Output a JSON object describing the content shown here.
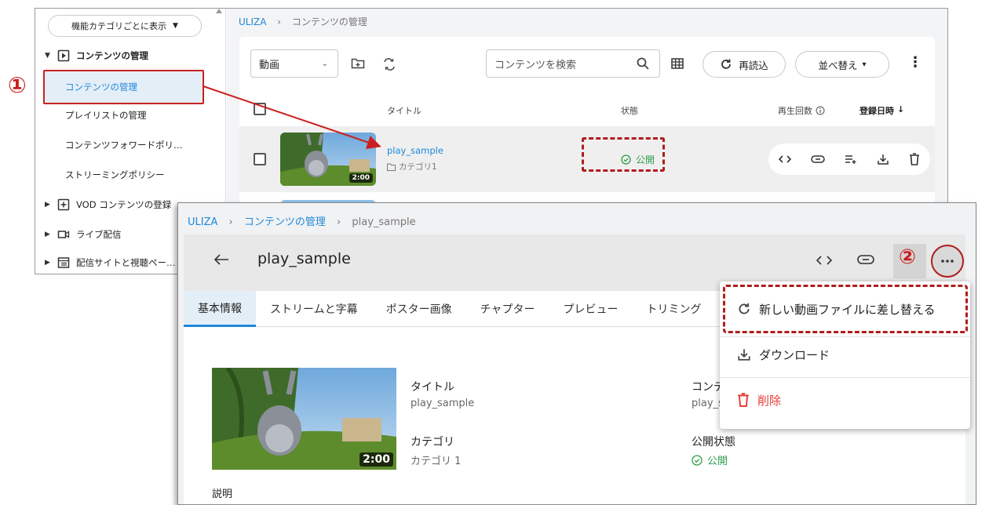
{
  "annotations": {
    "step1": "①",
    "step2": "②"
  },
  "sidebar": {
    "category_chip": "機能カテゴリごとに表示",
    "group_contents": "コンテンツの管理",
    "items": [
      "コンテンツの管理",
      "プレイリストの管理",
      "コンテンツフォワードポリ…",
      "ストリーミングポリシー"
    ],
    "group_vod": "VOD コンテンツの登録",
    "group_live": "ライブ配信",
    "group_site": "配信サイトと視聴ペー…"
  },
  "list_view": {
    "breadcrumb": {
      "root": "ULIZA",
      "current": "コンテンツの管理"
    },
    "type_select": "動画",
    "search_placeholder": "コンテンツを検索",
    "reload_label": "再読込",
    "sort_label": "並べ替え",
    "columns": {
      "title": "タイトル",
      "status": "状態",
      "plays": "再生回数",
      "registered": "登録日時"
    },
    "rows": [
      {
        "title": "play_sample",
        "category": "カテゴリ1",
        "status": "公開",
        "duration": "2:00"
      }
    ]
  },
  "detail_view": {
    "breadcrumb": {
      "root": "ULIZA",
      "parent": "コンテンツの管理",
      "current": "play_sample"
    },
    "title": "play_sample",
    "tabs": [
      "基本情報",
      "ストリームと字幕",
      "ポスター画像",
      "チャプター",
      "プレビュー",
      "トリミング"
    ],
    "fields": {
      "title_label": "タイトル",
      "title_value": "play_sample",
      "category_label": "カテゴリ",
      "category_value": "カテゴリ 1",
      "content_id_label": "コンテ",
      "content_id_value": "play_s",
      "publish_label": "公開状態",
      "publish_value": "公開",
      "description_label": "説明"
    },
    "duration": "2:00",
    "menu": [
      {
        "label": "新しい動画ファイルに差し替える",
        "icon": "refresh-icon"
      },
      {
        "label": "ダウンロード",
        "icon": "download-icon"
      },
      {
        "label": "削除",
        "icon": "trash-icon",
        "color": "#e53935"
      }
    ]
  },
  "colors": {
    "link": "#1e88d9",
    "status_green": "#2e9e48",
    "annotation_red": "#c9211e",
    "delete_red": "#e53935"
  }
}
